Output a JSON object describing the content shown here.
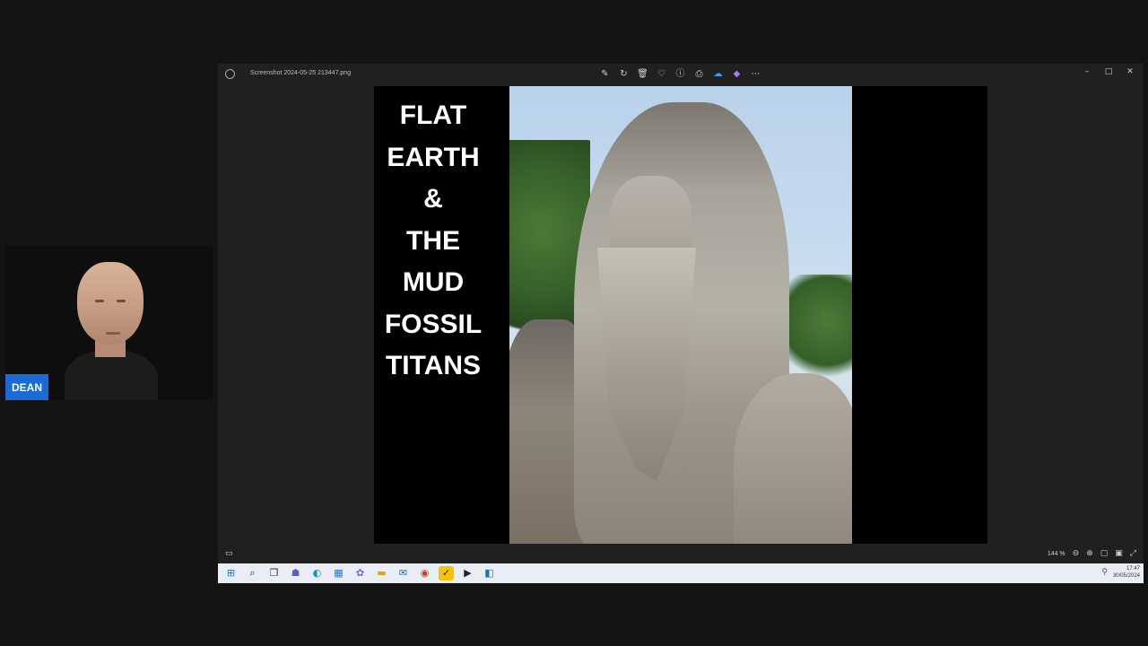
{
  "participant": {
    "name": "DEAN"
  },
  "window": {
    "file_title": "Screenshot 2024-05-25 213447.png",
    "toolbar_icons": [
      "edit-icon",
      "rotate-icon",
      "delete-icon",
      "favorite-icon",
      "info-icon",
      "print-icon",
      "onedrive-icon",
      "copilot-icon",
      "more-icon"
    ],
    "window_controls": [
      "minimize-icon",
      "maximize-icon",
      "close-icon"
    ],
    "zoom_label": "144 %"
  },
  "slide": {
    "title_lines": [
      "FLAT",
      "EARTH",
      "&",
      "THE",
      "MUD",
      "FOSSIL",
      "TITANS"
    ]
  },
  "taskbar": {
    "icons": [
      "start-icon",
      "search-icon",
      "task-view-icon",
      "teams-icon",
      "edge-icon",
      "store-icon",
      "copilot-icon",
      "file-explorer-icon",
      "mail-icon",
      "chrome-icon",
      "norton-icon",
      "media-player-icon",
      "app-icon"
    ],
    "time": "17:47",
    "date": "30/05/2024"
  }
}
